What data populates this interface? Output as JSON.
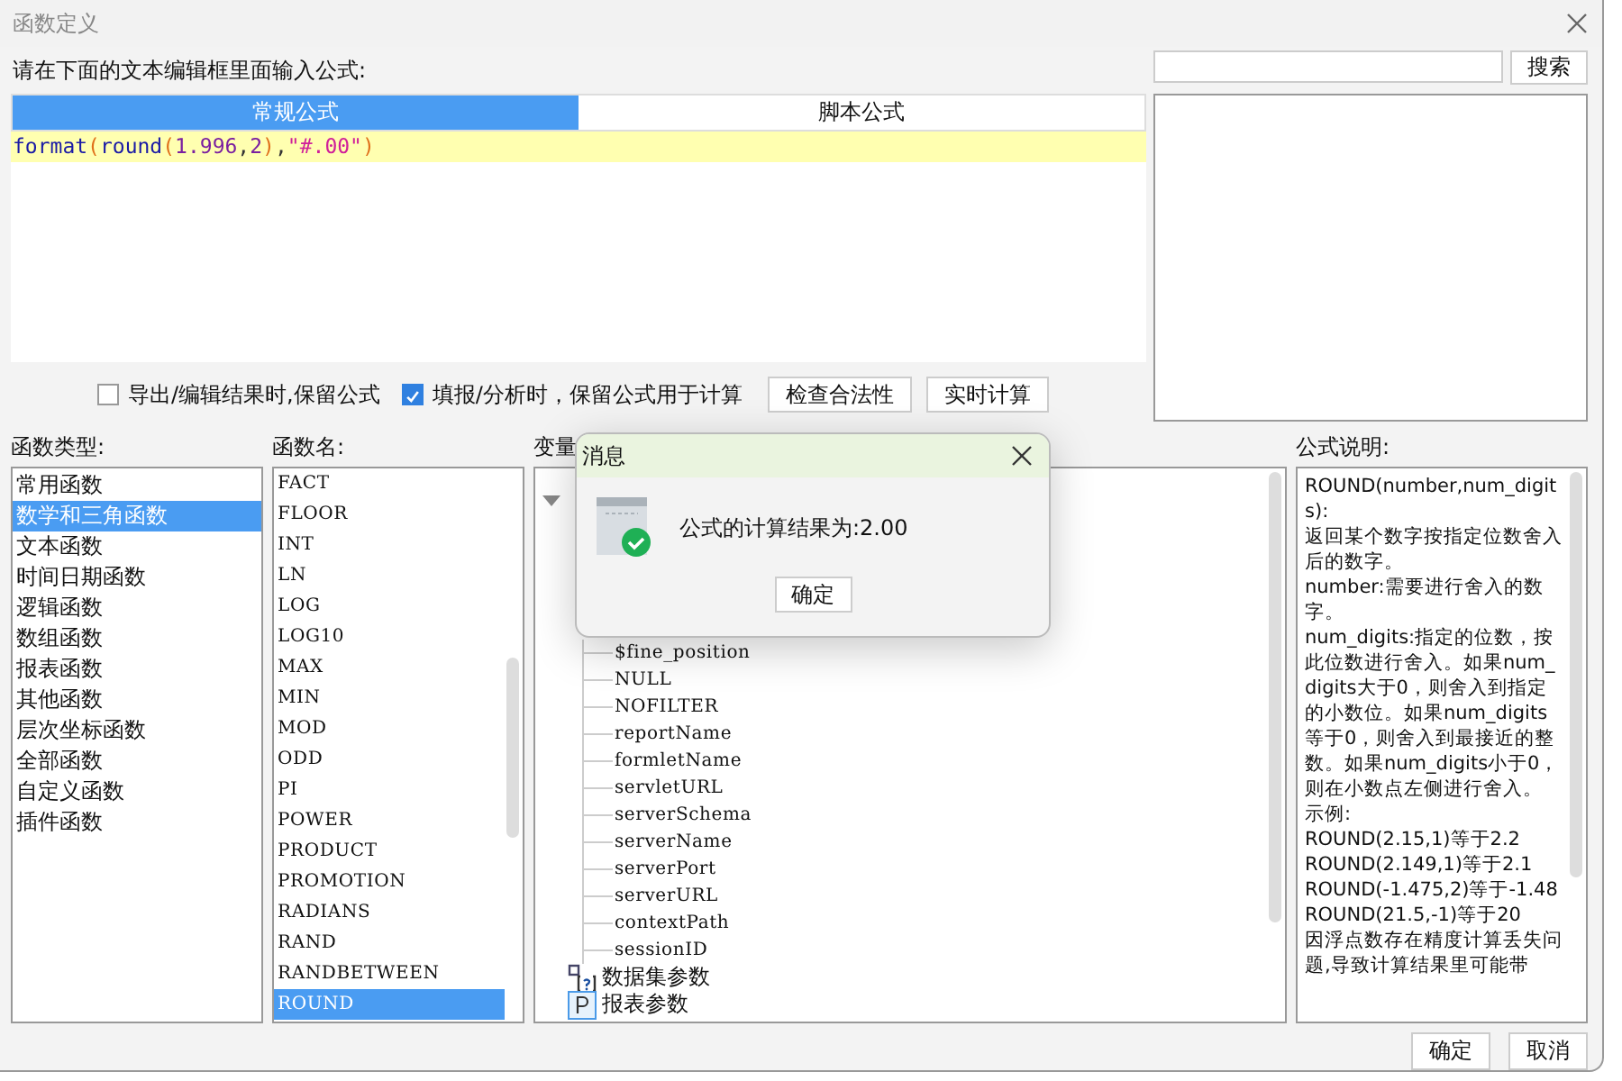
{
  "window": {
    "title": "函数定义"
  },
  "prompt": "请在下面的文本编辑框里面输入公式:",
  "tabs": [
    {
      "label": "常规公式",
      "selected": true
    },
    {
      "label": "脚本公式",
      "selected": false
    }
  ],
  "formula": [
    {
      "text": "format",
      "kind": "func"
    },
    {
      "text": "(",
      "kind": "paren"
    },
    {
      "text": "round",
      "kind": "func"
    },
    {
      "text": "(",
      "kind": "paren"
    },
    {
      "text": "1.996",
      "kind": "number"
    },
    {
      "text": ",",
      "kind": "punct"
    },
    {
      "text": "2",
      "kind": "number"
    },
    {
      "text": ")",
      "kind": "paren"
    },
    {
      "text": ",",
      "kind": "punct"
    },
    {
      "text": "\"#.00\"",
      "kind": "string"
    },
    {
      "text": ")",
      "kind": "paren"
    }
  ],
  "search": {
    "button": "搜索"
  },
  "options": [
    {
      "label": "导出/编辑结果时,保留公式",
      "checked": false
    },
    {
      "label": "填报/分析时，保留公式用于计算",
      "checked": true
    }
  ],
  "actions": [
    "检查合法性",
    "实时计算"
  ],
  "type_list": {
    "label": "函数类型:",
    "items": [
      {
        "label": "常用函数",
        "selected": false
      },
      {
        "label": "数学和三角函数",
        "selected": true
      },
      {
        "label": "文本函数",
        "selected": false
      },
      {
        "label": "时间日期函数",
        "selected": false
      },
      {
        "label": "逻辑函数",
        "selected": false
      },
      {
        "label": "数组函数",
        "selected": false
      },
      {
        "label": "报表函数",
        "selected": false
      },
      {
        "label": "其他函数",
        "selected": false
      },
      {
        "label": "层次坐标函数",
        "selected": false
      },
      {
        "label": "全部函数",
        "selected": false
      },
      {
        "label": "自定义函数",
        "selected": false
      },
      {
        "label": "插件函数",
        "selected": false
      }
    ]
  },
  "name_list": {
    "label": "函数名:",
    "items": [
      {
        "label": "FACT",
        "selected": false
      },
      {
        "label": "FLOOR",
        "selected": false
      },
      {
        "label": "INT",
        "selected": false
      },
      {
        "label": "LN",
        "selected": false
      },
      {
        "label": "LOG",
        "selected": false
      },
      {
        "label": "LOG10",
        "selected": false
      },
      {
        "label": "MAX",
        "selected": false
      },
      {
        "label": "MIN",
        "selected": false
      },
      {
        "label": "MOD",
        "selected": false
      },
      {
        "label": "ODD",
        "selected": false
      },
      {
        "label": "PI",
        "selected": false
      },
      {
        "label": "POWER",
        "selected": false
      },
      {
        "label": "PRODUCT",
        "selected": false
      },
      {
        "label": "PROMOTION",
        "selected": false
      },
      {
        "label": "RADIANS",
        "selected": false
      },
      {
        "label": "RAND",
        "selected": false
      },
      {
        "label": "RANDBETWEEN",
        "selected": false
      },
      {
        "label": "ROUND",
        "selected": true
      }
    ]
  },
  "variables": {
    "label": "变量",
    "expanded": true,
    "children": [
      "$fine_position",
      "NULL",
      "NOFILTER",
      "reportName",
      "formletName",
      "servletURL",
      "serverSchema",
      "serverName",
      "serverPort",
      "serverURL",
      "contextPath",
      "sessionID"
    ],
    "groups": [
      {
        "label": "数据集参数",
        "kind": "dataset"
      },
      {
        "label": "报表参数",
        "kind": "param"
      }
    ]
  },
  "description": {
    "label": "公式说明:",
    "lines": [
      "ROUND(number,num_digits):",
      "返回某个数字按指定位数舍入后的数字。",
      "number:需要进行舍入的数字。",
      "num_digits:指定的位数，按此位数进行舍入。如果num_digits大于0，则舍入到指定的小数位。如果num_digits等于0，则舍入到最接近的整数。如果num_digits小于0，则在小数点左侧进行舍入。",
      "示例:",
      "ROUND(2.15,1)等于2.2",
      "ROUND(2.149,1)等于2.1",
      "ROUND(-1.475,2)等于-1.48",
      "ROUND(21.5,-1)等于20",
      "因浮点数存在精度计算丢失问题,导致计算结果里可能带"
    ]
  },
  "footer": [
    "确定",
    "取消"
  ],
  "message": {
    "title": "消息",
    "text": "公式的计算结果为:2.00",
    "button": "确定"
  }
}
